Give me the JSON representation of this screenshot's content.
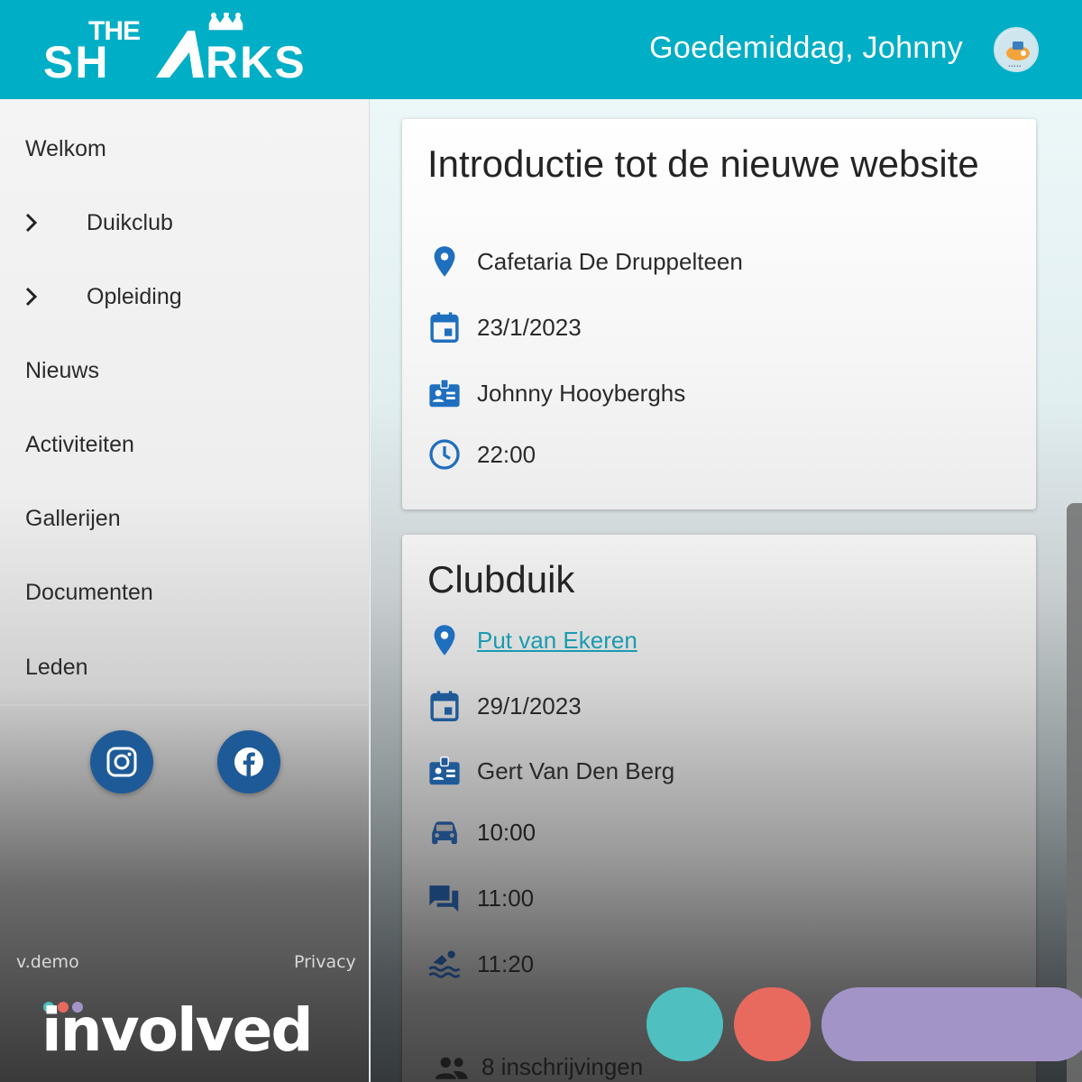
{
  "header": {
    "logo_text_top": "THE",
    "logo_text_main": "SHARKS",
    "greeting": "Goedemiddag, Johnny",
    "bg_color": "#00aec6"
  },
  "sidebar": {
    "items": [
      {
        "label": "Welkom",
        "expandable": false
      },
      {
        "label": "Duikclub",
        "expandable": true
      },
      {
        "label": "Opleiding",
        "expandable": true
      },
      {
        "label": "Nieuws",
        "expandable": false
      },
      {
        "label": "Activiteiten",
        "expandable": false
      },
      {
        "label": "Gallerijen",
        "expandable": false
      },
      {
        "label": "Documenten",
        "expandable": false
      },
      {
        "label": "Leden",
        "expandable": false
      }
    ],
    "social": [
      {
        "icon": "instagram-icon"
      },
      {
        "icon": "facebook-icon"
      }
    ],
    "version": "v.demo",
    "privacy": "Privacy"
  },
  "events": [
    {
      "title": "Introductie tot de nieuwe website",
      "location": "Cafetaria De Druppelteen",
      "date": "23/1/2023",
      "organizer": "Johnny Hooyberghs",
      "time": "22:00"
    },
    {
      "title": "Clubduik",
      "location": "Put van Ekeren",
      "date": "29/1/2023",
      "organizer": "Gert Van Den Berg",
      "departure": "10:00",
      "briefing": "11:00",
      "dive": "11:20",
      "registrations": "8 inschrijvingen"
    }
  ],
  "overlay": {
    "brand": "involved",
    "colors": [
      "#4fbfbf",
      "#e86a5f",
      "#a394c8"
    ]
  }
}
